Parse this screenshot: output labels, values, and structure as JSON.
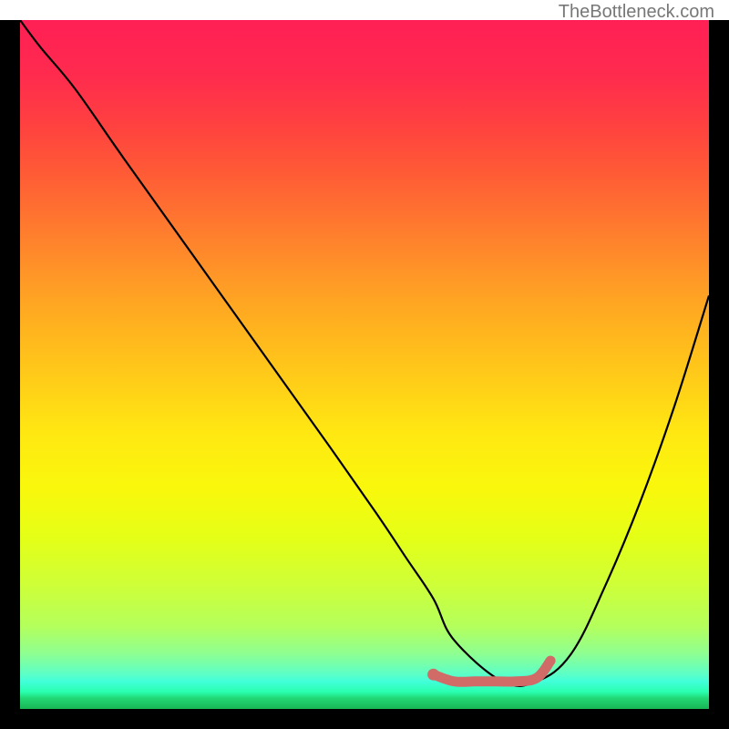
{
  "attribution": "TheBottleneck.com",
  "chart_data": {
    "type": "line",
    "title": "",
    "xlabel": "",
    "ylabel": "",
    "xlim": [
      0,
      100
    ],
    "ylim": [
      0,
      100
    ],
    "gradient_stops": [
      {
        "pos": 0,
        "color": "#ff1f55"
      },
      {
        "pos": 15,
        "color": "#ff4040"
      },
      {
        "pos": 30,
        "color": "#ff7a2e"
      },
      {
        "pos": 45,
        "color": "#ffb41e"
      },
      {
        "pos": 60,
        "color": "#ffe812"
      },
      {
        "pos": 75,
        "color": "#e5ff16"
      },
      {
        "pos": 88,
        "color": "#b4ff5c"
      },
      {
        "pos": 95,
        "color": "#5bffc8"
      },
      {
        "pos": 100,
        "color": "#19b554"
      }
    ],
    "series": [
      {
        "name": "bottleneck-curve",
        "color": "#000000",
        "x": [
          0,
          3,
          8,
          15,
          25,
          35,
          45,
          52,
          56,
          60,
          63,
          70,
          75,
          80,
          85,
          90,
          95,
          100
        ],
        "y": [
          100,
          96,
          90,
          80,
          66,
          52,
          38,
          28,
          22,
          16,
          10,
          4,
          4,
          8,
          18,
          30,
          44,
          60
        ]
      }
    ],
    "highlight": {
      "name": "optimal-range",
      "color": "#d16b68",
      "x": [
        60,
        63,
        66,
        69,
        72,
        75,
        77
      ],
      "y": [
        5,
        4,
        4,
        4,
        4,
        4.5,
        7
      ]
    }
  }
}
